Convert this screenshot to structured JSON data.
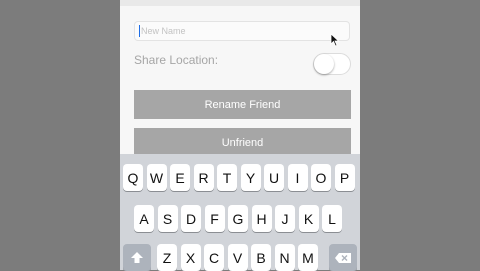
{
  "form": {
    "name_placeholder": "New Name",
    "share_location_label": "Share Location:",
    "share_location_on": false,
    "rename_button": "Rename Friend",
    "unfriend_button": "Unfriend"
  },
  "keyboard": {
    "row1": [
      "Q",
      "W",
      "E",
      "R",
      "T",
      "Y",
      "U",
      "I",
      "O",
      "P"
    ],
    "row2": [
      "A",
      "S",
      "D",
      "F",
      "G",
      "H",
      "J",
      "K",
      "L"
    ],
    "row3": [
      "Z",
      "X",
      "C",
      "V",
      "B",
      "N",
      "M"
    ],
    "shift_icon": "shift-arrow-icon",
    "delete_icon": "delete-backspace-icon"
  }
}
